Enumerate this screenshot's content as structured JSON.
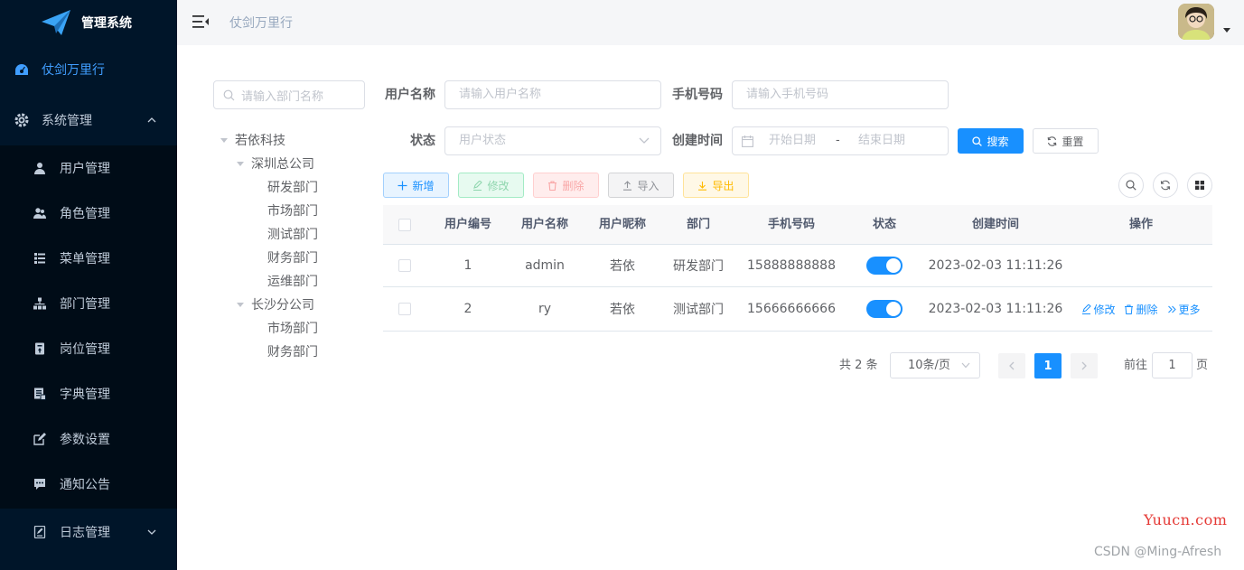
{
  "app": {
    "title": "管理系统"
  },
  "sidebar": {
    "home": "仗剑万里行",
    "system": "系统管理",
    "items": [
      {
        "label": "用户管理",
        "icon": "user-icon"
      },
      {
        "label": "角色管理",
        "icon": "peoples-icon"
      },
      {
        "label": "菜单管理",
        "icon": "tree-table-icon"
      },
      {
        "label": "部门管理",
        "icon": "tree-icon"
      },
      {
        "label": "岗位管理",
        "icon": "post-icon"
      },
      {
        "label": "字典管理",
        "icon": "dict-icon"
      },
      {
        "label": "参数设置",
        "icon": "edit-icon"
      },
      {
        "label": "通知公告",
        "icon": "message-icon"
      }
    ],
    "log": "日志管理",
    "active_color": "#409eff"
  },
  "navbar": {
    "breadcrumb": "仗剑万里行"
  },
  "dept": {
    "placeholder": "请输入部门名称",
    "tree": {
      "root": "若依科技",
      "branch1": "深圳总公司",
      "branch1_children": [
        "研发部门",
        "市场部门",
        "测试部门",
        "财务部门",
        "运维部门"
      ],
      "branch2": "长沙分公司",
      "branch2_children": [
        "市场部门",
        "财务部门"
      ]
    }
  },
  "query": {
    "username_label": "用户名称",
    "username_placeholder": "请输入用户名称",
    "phone_label": "手机号码",
    "phone_placeholder": "请输入手机号码",
    "status_label": "状态",
    "status_placeholder": "用户状态",
    "time_label": "创建时间",
    "start_placeholder": "开始日期",
    "sep": "-",
    "end_placeholder": "结束日期",
    "search": "搜索",
    "reset": "重置"
  },
  "toolbar": {
    "add": "新增",
    "edit": "修改",
    "delete": "删除",
    "import": "导入",
    "export": "导出"
  },
  "table": {
    "headers": [
      "用户编号",
      "用户名称",
      "用户昵称",
      "部门",
      "手机号码",
      "状态",
      "创建时间",
      "操作"
    ],
    "rows": [
      {
        "id": "1",
        "username": "admin",
        "nickname": "若依",
        "dept": "研发部门",
        "phone": "15888888888",
        "status": true,
        "created": "2023-02-03 11:11:26"
      },
      {
        "id": "2",
        "username": "ry",
        "nickname": "若依",
        "dept": "测试部门",
        "phone": "15666666666",
        "status": true,
        "created": "2023-02-03 11:11:26"
      }
    ],
    "ops": {
      "edit": "修改",
      "delete": "删除",
      "more": "更多"
    }
  },
  "pagination": {
    "total": "共 2 条",
    "page_size": "10条/页",
    "current": "1",
    "goto": "前往",
    "goto_value": "1",
    "page": "页"
  },
  "watermark": {
    "site": "Yuucn.com",
    "credit": "CSDN @Ming-Afresh"
  },
  "colors": {
    "primary": "#1890ff",
    "sidebar_bg": "#001529"
  }
}
